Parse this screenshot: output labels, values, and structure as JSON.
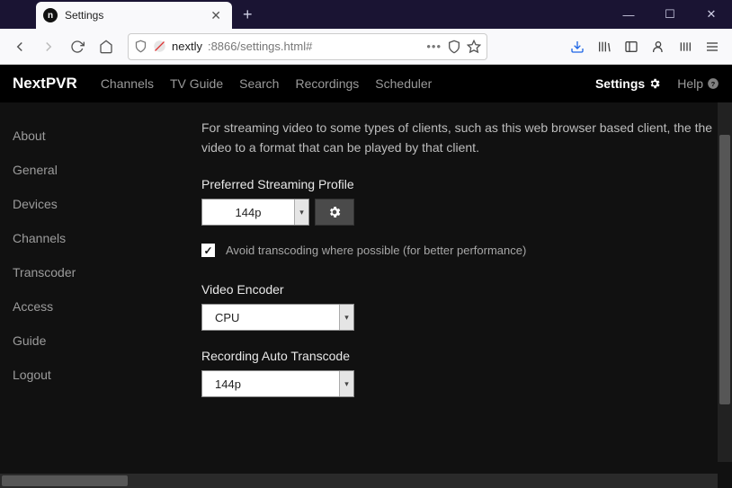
{
  "browser": {
    "tab_title": "Settings",
    "url_display": {
      "host": "nextly",
      "rest": ":8866/settings.html#"
    }
  },
  "topnav": {
    "brand": "NextPVR",
    "items": [
      "Channels",
      "TV Guide",
      "Search",
      "Recordings",
      "Scheduler"
    ],
    "settings": "Settings",
    "help": "Help"
  },
  "sidebar": {
    "items": [
      "About",
      "General",
      "Devices",
      "Channels",
      "Transcoder",
      "Access",
      "Guide",
      "Logout"
    ]
  },
  "main": {
    "description": "For streaming video to some types of clients, such as this web browser based client, the the video to a format that can be played by that client.",
    "profile_label": "Preferred Streaming Profile",
    "profile_value": "144p",
    "avoid_label": "Avoid transcoding where possible (for better performance)",
    "avoid_checked": true,
    "encoder_label": "Video Encoder",
    "encoder_value": "CPU",
    "autotranscode_label": "Recording Auto Transcode",
    "autotranscode_value": "144p"
  }
}
